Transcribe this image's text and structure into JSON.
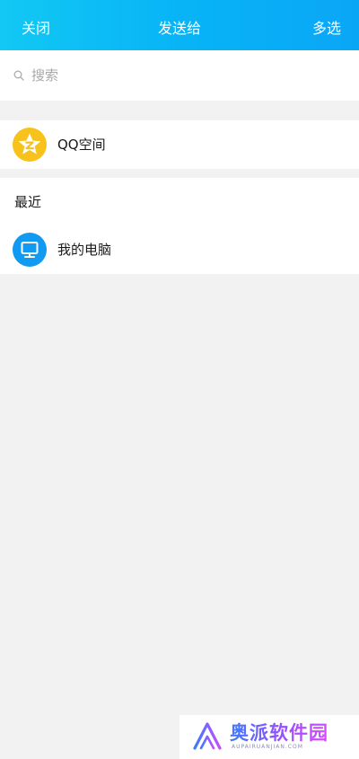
{
  "header": {
    "close_label": "关闭",
    "title": "发送给",
    "multi_select_label": "多选"
  },
  "search": {
    "placeholder": "搜索"
  },
  "qzone": {
    "label": "QQ空间"
  },
  "recent": {
    "header": "最近",
    "items": [
      {
        "label": "我的电脑",
        "icon": "computer-icon"
      }
    ]
  },
  "watermark": {
    "brand": "奥派软件园",
    "sub": "AUPAIRUANJIAN.COM"
  },
  "colors": {
    "header_start": "#12c8f4",
    "header_end": "#0aa6f6",
    "qzone_yellow": "#f6c21b",
    "pc_blue": "#119af1",
    "background": "#f2f2f2"
  }
}
